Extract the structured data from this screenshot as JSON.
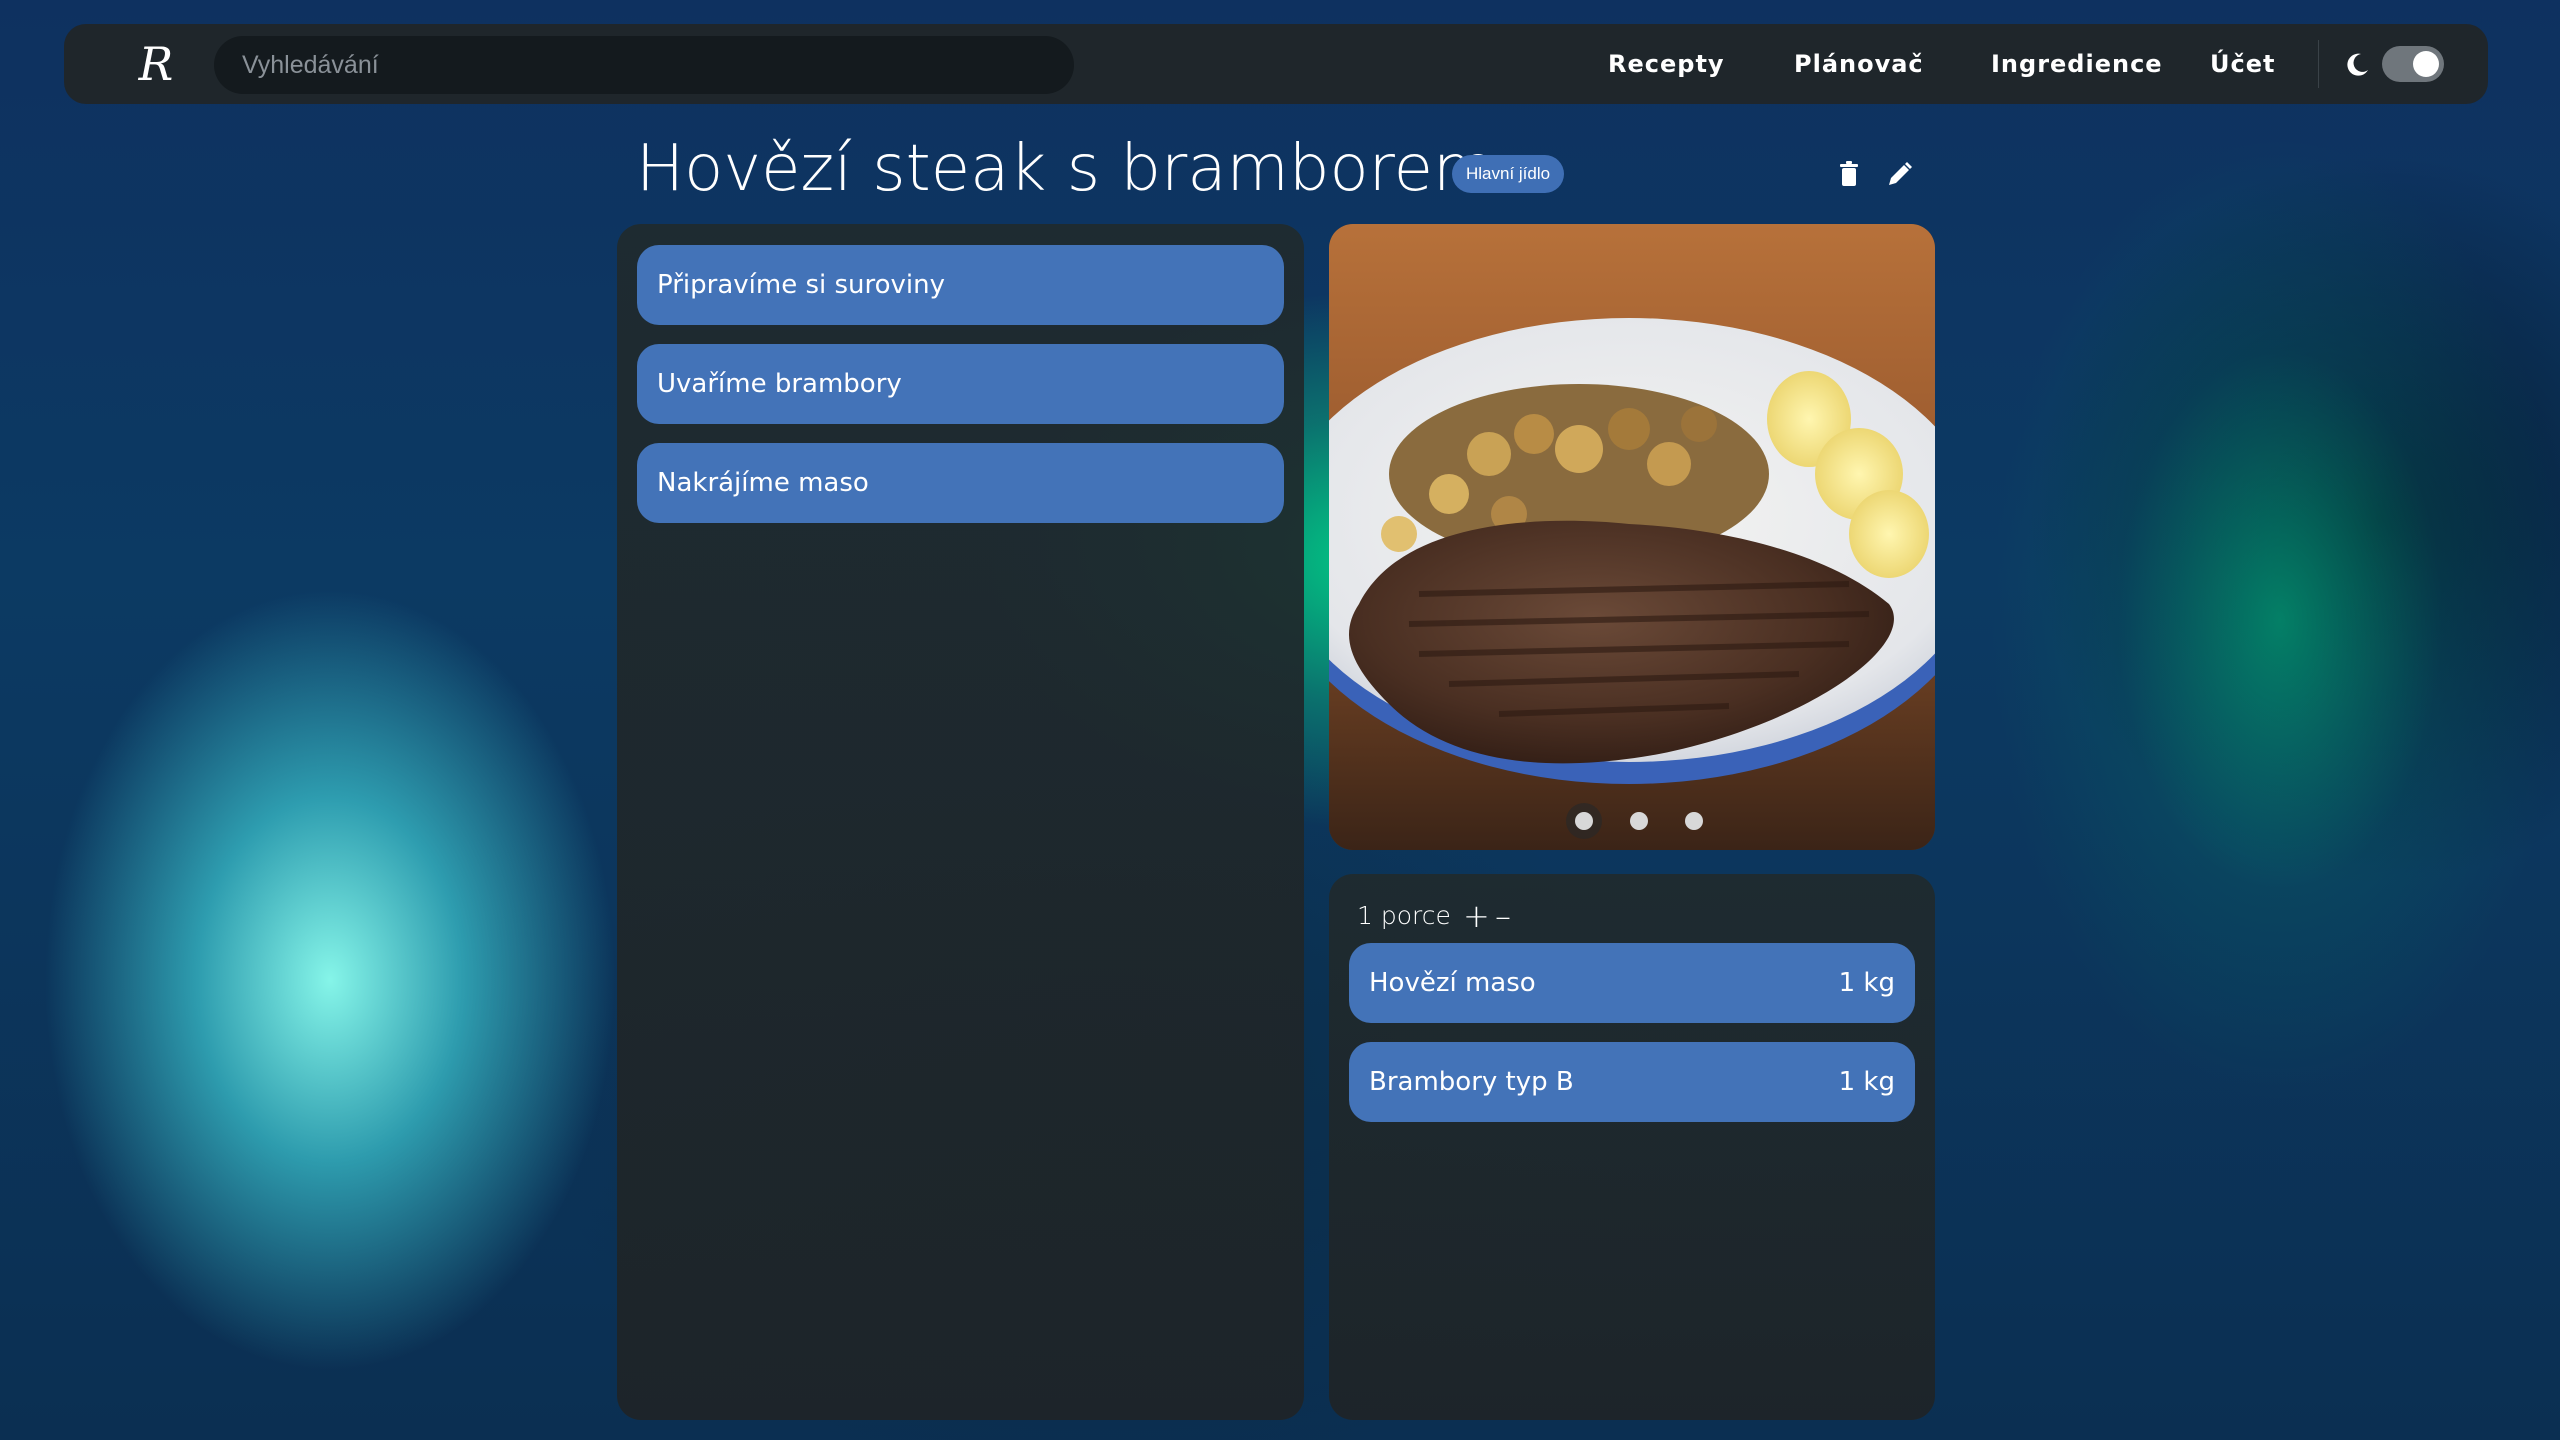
{
  "navbar": {
    "logo_text": "R",
    "search_placeholder": "Vyhledávání",
    "links": [
      "Recepty",
      "Plánovač",
      "Ingredience",
      "Účet"
    ],
    "theme_toggle_on": true
  },
  "recipe": {
    "title": "Hovězí steak s bramborem",
    "category": "Hlavní jídlo",
    "steps": [
      "Připravíme si suroviny",
      "Uvaříme brambory",
      "Nakrájíme maso"
    ],
    "image_carousel": {
      "image_semantic": "steak-with-potatoes-and-corn-photo",
      "dot_count": 3,
      "active_index": 0
    },
    "portions": {
      "label": "1 porce",
      "increase_symbol": "+",
      "decrease_symbol": "–"
    },
    "ingredients": [
      {
        "name": "Hovězí maso",
        "amount": "1 kg"
      },
      {
        "name": "Brambory typ B",
        "amount": "1 kg"
      }
    ]
  },
  "icons": {
    "logo": "logo-icon",
    "theme": "moon-icon",
    "delete": "trash-icon",
    "edit": "pencil-icon"
  },
  "colors": {
    "accent_blue": "#4373b8",
    "badge_blue": "#3f6fb5",
    "panel_dark": "#1f262b",
    "navbar_dark": "#1f262b"
  }
}
